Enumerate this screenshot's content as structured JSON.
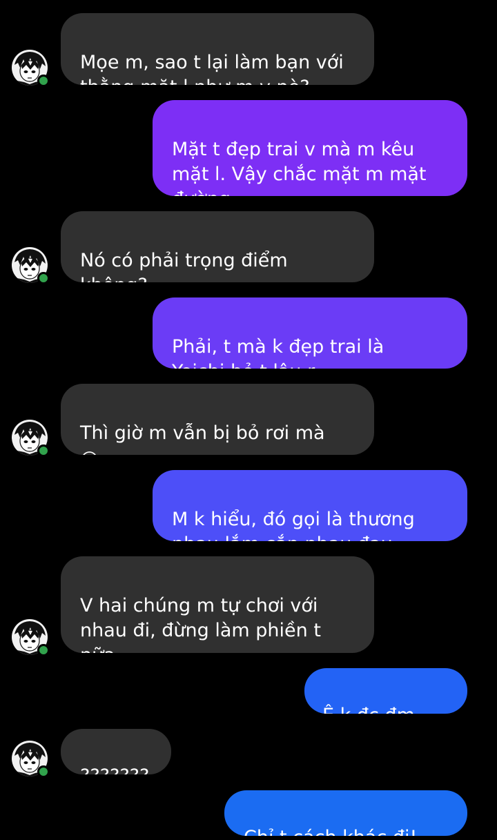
{
  "colors": {
    "background": "#000000",
    "incoming_bubble": "#303030",
    "gradient_purple": "#7d2ff5",
    "gradient_indigo": "#4d4ff8",
    "gradient_blue": "#1b6cf2",
    "online_status": "#31a24c"
  },
  "avatar": {
    "icon": "manga-boy-avatar",
    "status": "online"
  },
  "messages": [
    {
      "sender": "them",
      "text": "Mọe m, sao t lại làm bạn với\nthằng mặt l như m v nè?",
      "emoji": "😊"
    },
    {
      "sender": "me",
      "text": "Mặt t đẹp trai v mà m kêu\nmặt l. Vậy chắc mặt m mặt\nđường",
      "emoji": "😏"
    },
    {
      "sender": "them",
      "text": "Nó có phải trọng điểm\nkhông?",
      "emoji": "🙃"
    },
    {
      "sender": "me",
      "text": "Phải, t mà k đẹp trai là\nYoichi bỏ t lâu r",
      "emoji": "😒"
    },
    {
      "sender": "them",
      "text": "Thì giờ m vẫn bị bỏ rơi mà\n",
      "emoji": "😀"
    },
    {
      "sender": "me",
      "text": "M k hiểu, đó gọi là thương\nnhau lắm cắn nhau đau",
      "emoji": "😘"
    },
    {
      "sender": "them",
      "text": "V hai chúng m tự chơi với\nnhau đi, đừng làm phiền t\nnữa",
      "emoji": "🤗"
    },
    {
      "sender": "me",
      "text": "Ê k đc đm",
      "emoji": "😡"
    },
    {
      "sender": "them",
      "text": "???????",
      "emoji": ""
    },
    {
      "sender": "me",
      "text": "Chỉ t cách khác đi!",
      "emoji": "😡"
    }
  ]
}
